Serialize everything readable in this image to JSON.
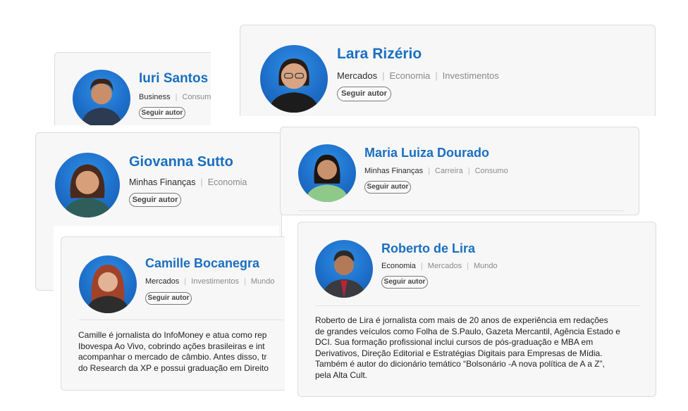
{
  "authors": {
    "iuri": {
      "name": "Iuri Santos",
      "tags": [
        "Business",
        "Consumo"
      ],
      "follow": "Seguir autor"
    },
    "lara": {
      "name": "Lara Rizério",
      "tags": [
        "Mercados",
        "Economia",
        "Investimentos"
      ],
      "follow": "Seguir autor"
    },
    "giovanna": {
      "name": "Giovanna Sutto",
      "tags": [
        "Minhas Finanças",
        "Economia"
      ],
      "follow": "Seguir autor"
    },
    "maria": {
      "name": "Maria Luiza Dourado",
      "tags": [
        "Minhas Finanças",
        "Carreira",
        "Consumo"
      ],
      "follow": "Seguir autor"
    },
    "camille": {
      "name": "Camille Bocanegra",
      "tags": [
        "Mercados",
        "Investimentos",
        "Mundo"
      ],
      "follow": "Seguir autor",
      "bio": [
        "Camille é jornalista do InfoMoney e atua como rep",
        "Ibovespa Ao Vivo, cobrindo ações brasileiras e int",
        "acompanhar o mercado de câmbio. Antes disso, tr",
        "do Research da XP e possui graduação em Direito"
      ]
    },
    "roberto": {
      "name": "Roberto de Lira",
      "tags": [
        "Economia",
        "Mercados",
        "Mundo"
      ],
      "follow": "Seguir autor",
      "bio": [
        "Roberto de Lira é jornalista com mais de 20 anos de experiência em redações",
        "de grandes veículos como Folha de S.Paulo, Gazeta Mercantil, Agência Estado e",
        "DCI. Sua formação profissional inclui cursos de pós-graduação e MBA em",
        "Derivativos, Direção Editorial e Estratégias Digitais para Empresas de Mídia.",
        "Também é autor do dicionário temático “Bolsonário -A nova política de A a Z”,",
        "pela Alta Cult."
      ]
    }
  },
  "colors": {
    "name": "#1a6fc0",
    "avatar_bg": "#1e6fc9",
    "card_bg": "#f7f7f7"
  }
}
